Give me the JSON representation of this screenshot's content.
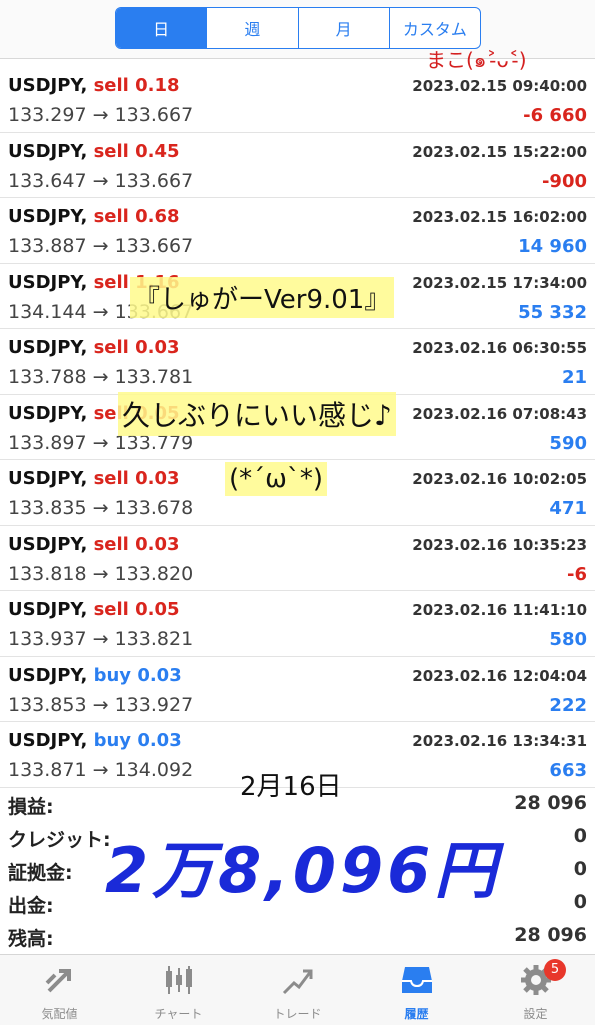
{
  "tabs": [
    "日",
    "週",
    "月",
    "カスタム"
  ],
  "trades": [
    {
      "symbol": "USDJPY,",
      "side": "sell",
      "lots": "0.18",
      "time": "2023.02.15 09:40:00",
      "open": "133.297",
      "close": "133.667",
      "profit": "-6 660",
      "sign": "neg"
    },
    {
      "symbol": "USDJPY,",
      "side": "sell",
      "lots": "0.45",
      "time": "2023.02.15 15:22:00",
      "open": "133.647",
      "close": "133.667",
      "profit": "-900",
      "sign": "neg"
    },
    {
      "symbol": "USDJPY,",
      "side": "sell",
      "lots": "0.68",
      "time": "2023.02.15 16:02:00",
      "open": "133.887",
      "close": "133.667",
      "profit": "14 960",
      "sign": "pos"
    },
    {
      "symbol": "USDJPY,",
      "side": "sell",
      "lots": "1.16",
      "time": "2023.02.15 17:34:00",
      "open": "134.144",
      "close": "133.667",
      "profit": "55 332",
      "sign": "pos"
    },
    {
      "symbol": "USDJPY,",
      "side": "sell",
      "lots": "0.03",
      "time": "2023.02.16 06:30:55",
      "open": "133.788",
      "close": "133.781",
      "profit": "21",
      "sign": "pos"
    },
    {
      "symbol": "USDJPY,",
      "side": "sell",
      "lots": "0.05",
      "time": "2023.02.16 07:08:43",
      "open": "133.897",
      "close": "133.779",
      "profit": "590",
      "sign": "pos"
    },
    {
      "symbol": "USDJPY,",
      "side": "sell",
      "lots": "0.03",
      "time": "2023.02.16 10:02:05",
      "open": "133.835",
      "close": "133.678",
      "profit": "471",
      "sign": "pos"
    },
    {
      "symbol": "USDJPY,",
      "side": "sell",
      "lots": "0.03",
      "time": "2023.02.16 10:35:23",
      "open": "133.818",
      "close": "133.820",
      "profit": "-6",
      "sign": "neg"
    },
    {
      "symbol": "USDJPY,",
      "side": "sell",
      "lots": "0.05",
      "time": "2023.02.16 11:41:10",
      "open": "133.937",
      "close": "133.821",
      "profit": "580",
      "sign": "pos"
    },
    {
      "symbol": "USDJPY,",
      "side": "buy",
      "lots": "0.03",
      "time": "2023.02.16 12:04:04",
      "open": "133.853",
      "close": "133.927",
      "profit": "222",
      "sign": "pos"
    },
    {
      "symbol": "USDJPY,",
      "side": "buy",
      "lots": "0.03",
      "time": "2023.02.16 13:34:31",
      "open": "133.871",
      "close": "134.092",
      "profit": "663",
      "sign": "pos"
    }
  ],
  "arrow": "→",
  "summary": [
    {
      "label": "損益:",
      "value": "28 096"
    },
    {
      "label": "クレジット:",
      "value": "0"
    },
    {
      "label": "証拠金:",
      "value": "0"
    },
    {
      "label": "出金:",
      "value": "0"
    },
    {
      "label": "残高:",
      "value": "28 096"
    }
  ],
  "tabbar": [
    {
      "label": "気配値",
      "icon": "quotes-icon"
    },
    {
      "label": "チャート",
      "icon": "chart-icon"
    },
    {
      "label": "トレード",
      "icon": "trade-icon"
    },
    {
      "label": "履歴",
      "icon": "history-icon",
      "active": true
    },
    {
      "label": "設定",
      "icon": "settings-icon",
      "badge": "5"
    }
  ],
  "annotations": {
    "name": "まこ(๑˃̵ᴗ˂̵)",
    "version": "『しゅがーVer9.01』",
    "feeling": "久しぶりにいい感じ♪",
    "face": "(*´ω`*)",
    "date": "2月16日",
    "total": "2万8,096円"
  },
  "colors": {
    "accent": "#2a7ef0",
    "negative": "#d9251d",
    "badge": "#e8372b"
  }
}
